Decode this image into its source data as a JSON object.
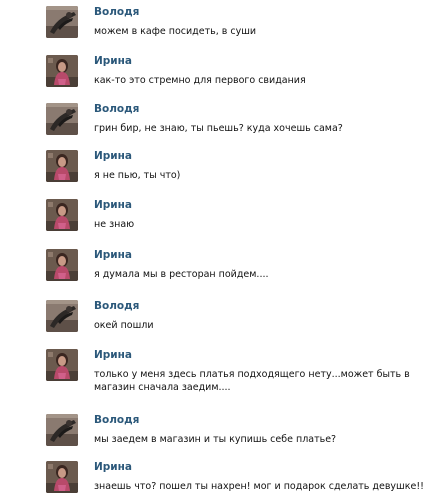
{
  "messages": [
    {
      "author": "Володя",
      "text": "можем в кафе посидеть, в суши",
      "avatar_icon": "volodya-avatar"
    },
    {
      "author": "Ирина",
      "text": "как-то это стремно для первого свидания",
      "avatar_icon": "irina-avatar"
    },
    {
      "author": "Володя",
      "text": "грин бир, не знаю, ты пьешь? куда хочешь сама?",
      "avatar_icon": "volodya-avatar"
    },
    {
      "author": "Ирина",
      "text": "я не пью, ты что)",
      "avatar_icon": "irina-avatar"
    },
    {
      "author": "Ирина",
      "text": "не знаю",
      "avatar_icon": "irina-avatar"
    },
    {
      "author": "Ирина",
      "text": "я думала мы в ресторан пойдем....",
      "avatar_icon": "irina-avatar"
    },
    {
      "author": "Володя",
      "text": "окей пошли",
      "avatar_icon": "volodya-avatar"
    },
    {
      "author": "Ирина",
      "text": "только у меня здесь платья подходящего нету...может быть в магазин сначала заедим....",
      "avatar_icon": "irina-avatar"
    },
    {
      "author": "Володя",
      "text": "мы заедем в магазин и ты купишь себе платье?",
      "avatar_icon": "volodya-avatar"
    },
    {
      "author": "Ирина",
      "text": "знаешь что? пошел ты нахрен! мог и подарок сделать девушке!!",
      "avatar_icon": "irina-avatar"
    }
  ],
  "colors": {
    "author_link": "#2b587a",
    "message_text": "#111111",
    "background": "#ffffff"
  }
}
